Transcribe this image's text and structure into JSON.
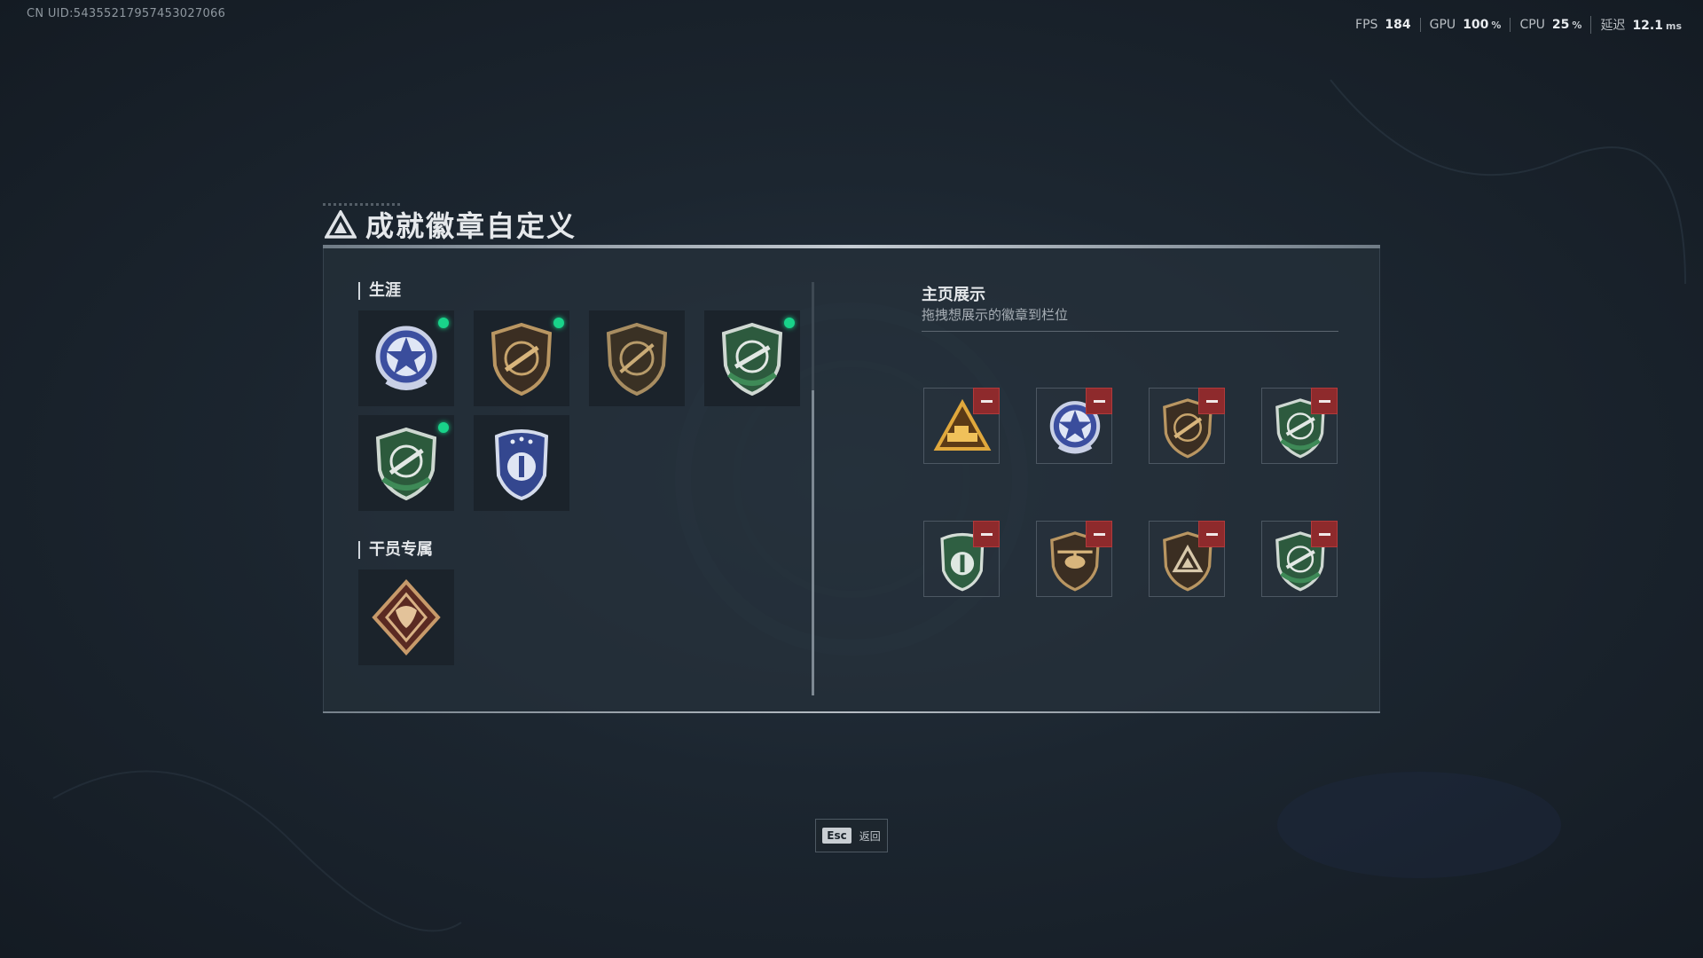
{
  "header": {
    "uid": "CN UID:543552179574530270​66",
    "perf": {
      "fps_label": "FPS",
      "fps_value": "184",
      "gpu_label": "GPU",
      "gpu_value": "100",
      "gpu_unit": "%",
      "cpu_label": "CPU",
      "cpu_value": "25",
      "cpu_unit": "%",
      "latency_label": "延迟",
      "latency_value": "12.1",
      "latency_unit": "ms"
    }
  },
  "page": {
    "title": "成就徽章自定义"
  },
  "sections": {
    "career": {
      "label": "生涯",
      "badges": [
        {
          "icon": "blue-star-badge-icon",
          "new": true
        },
        {
          "icon": "bronze-rifle-shield-icon",
          "new": true
        },
        {
          "icon": "bronze-sniper-shield-icon",
          "new": false
        },
        {
          "icon": "green-rocket-shield-icon",
          "new": true
        },
        {
          "icon": "green-rifle-shield-icon",
          "new": true
        },
        {
          "icon": "blue-police-shield-icon",
          "new": false
        }
      ]
    },
    "operator": {
      "label": "干员专属",
      "badges": [
        {
          "icon": "dragon-diamond-badge-icon",
          "new": false
        }
      ]
    }
  },
  "display": {
    "title": "主页展示",
    "subtitle": "拖拽想展示的徽章到栏位",
    "slots": [
      {
        "icon": "gold-vehicle-triangle-icon"
      },
      {
        "icon": "blue-star-badge-icon"
      },
      {
        "icon": "bronze-rifle-shield-icon"
      },
      {
        "icon": "green-rocket-shield-icon"
      },
      {
        "icon": "green-police-shield-icon"
      },
      {
        "icon": "bronze-helicopter-shield-icon"
      },
      {
        "icon": "bronze-delta-shield-icon"
      },
      {
        "icon": "green-rocket-shield-icon"
      }
    ]
  },
  "footer": {
    "esc_key": "Esc",
    "esc_label": "返回"
  },
  "colors": {
    "new_dot": "#19d38a",
    "remove": "#8e2a2c",
    "accent_line": "#c5ccd3"
  }
}
